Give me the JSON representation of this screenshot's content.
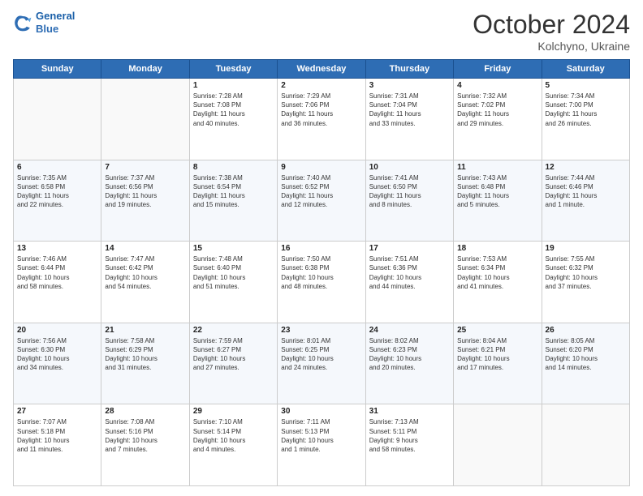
{
  "header": {
    "logo_line1": "General",
    "logo_line2": "Blue",
    "month_title": "October 2024",
    "location": "Kolchyno, Ukraine"
  },
  "weekdays": [
    "Sunday",
    "Monday",
    "Tuesday",
    "Wednesday",
    "Thursday",
    "Friday",
    "Saturday"
  ],
  "weeks": [
    [
      {
        "day": "",
        "info": ""
      },
      {
        "day": "",
        "info": ""
      },
      {
        "day": "1",
        "info": "Sunrise: 7:28 AM\nSunset: 7:08 PM\nDaylight: 11 hours\nand 40 minutes."
      },
      {
        "day": "2",
        "info": "Sunrise: 7:29 AM\nSunset: 7:06 PM\nDaylight: 11 hours\nand 36 minutes."
      },
      {
        "day": "3",
        "info": "Sunrise: 7:31 AM\nSunset: 7:04 PM\nDaylight: 11 hours\nand 33 minutes."
      },
      {
        "day": "4",
        "info": "Sunrise: 7:32 AM\nSunset: 7:02 PM\nDaylight: 11 hours\nand 29 minutes."
      },
      {
        "day": "5",
        "info": "Sunrise: 7:34 AM\nSunset: 7:00 PM\nDaylight: 11 hours\nand 26 minutes."
      }
    ],
    [
      {
        "day": "6",
        "info": "Sunrise: 7:35 AM\nSunset: 6:58 PM\nDaylight: 11 hours\nand 22 minutes."
      },
      {
        "day": "7",
        "info": "Sunrise: 7:37 AM\nSunset: 6:56 PM\nDaylight: 11 hours\nand 19 minutes."
      },
      {
        "day": "8",
        "info": "Sunrise: 7:38 AM\nSunset: 6:54 PM\nDaylight: 11 hours\nand 15 minutes."
      },
      {
        "day": "9",
        "info": "Sunrise: 7:40 AM\nSunset: 6:52 PM\nDaylight: 11 hours\nand 12 minutes."
      },
      {
        "day": "10",
        "info": "Sunrise: 7:41 AM\nSunset: 6:50 PM\nDaylight: 11 hours\nand 8 minutes."
      },
      {
        "day": "11",
        "info": "Sunrise: 7:43 AM\nSunset: 6:48 PM\nDaylight: 11 hours\nand 5 minutes."
      },
      {
        "day": "12",
        "info": "Sunrise: 7:44 AM\nSunset: 6:46 PM\nDaylight: 11 hours\nand 1 minute."
      }
    ],
    [
      {
        "day": "13",
        "info": "Sunrise: 7:46 AM\nSunset: 6:44 PM\nDaylight: 10 hours\nand 58 minutes."
      },
      {
        "day": "14",
        "info": "Sunrise: 7:47 AM\nSunset: 6:42 PM\nDaylight: 10 hours\nand 54 minutes."
      },
      {
        "day": "15",
        "info": "Sunrise: 7:48 AM\nSunset: 6:40 PM\nDaylight: 10 hours\nand 51 minutes."
      },
      {
        "day": "16",
        "info": "Sunrise: 7:50 AM\nSunset: 6:38 PM\nDaylight: 10 hours\nand 48 minutes."
      },
      {
        "day": "17",
        "info": "Sunrise: 7:51 AM\nSunset: 6:36 PM\nDaylight: 10 hours\nand 44 minutes."
      },
      {
        "day": "18",
        "info": "Sunrise: 7:53 AM\nSunset: 6:34 PM\nDaylight: 10 hours\nand 41 minutes."
      },
      {
        "day": "19",
        "info": "Sunrise: 7:55 AM\nSunset: 6:32 PM\nDaylight: 10 hours\nand 37 minutes."
      }
    ],
    [
      {
        "day": "20",
        "info": "Sunrise: 7:56 AM\nSunset: 6:30 PM\nDaylight: 10 hours\nand 34 minutes."
      },
      {
        "day": "21",
        "info": "Sunrise: 7:58 AM\nSunset: 6:29 PM\nDaylight: 10 hours\nand 31 minutes."
      },
      {
        "day": "22",
        "info": "Sunrise: 7:59 AM\nSunset: 6:27 PM\nDaylight: 10 hours\nand 27 minutes."
      },
      {
        "day": "23",
        "info": "Sunrise: 8:01 AM\nSunset: 6:25 PM\nDaylight: 10 hours\nand 24 minutes."
      },
      {
        "day": "24",
        "info": "Sunrise: 8:02 AM\nSunset: 6:23 PM\nDaylight: 10 hours\nand 20 minutes."
      },
      {
        "day": "25",
        "info": "Sunrise: 8:04 AM\nSunset: 6:21 PM\nDaylight: 10 hours\nand 17 minutes."
      },
      {
        "day": "26",
        "info": "Sunrise: 8:05 AM\nSunset: 6:20 PM\nDaylight: 10 hours\nand 14 minutes."
      }
    ],
    [
      {
        "day": "27",
        "info": "Sunrise: 7:07 AM\nSunset: 5:18 PM\nDaylight: 10 hours\nand 11 minutes."
      },
      {
        "day": "28",
        "info": "Sunrise: 7:08 AM\nSunset: 5:16 PM\nDaylight: 10 hours\nand 7 minutes."
      },
      {
        "day": "29",
        "info": "Sunrise: 7:10 AM\nSunset: 5:14 PM\nDaylight: 10 hours\nand 4 minutes."
      },
      {
        "day": "30",
        "info": "Sunrise: 7:11 AM\nSunset: 5:13 PM\nDaylight: 10 hours\nand 1 minute."
      },
      {
        "day": "31",
        "info": "Sunrise: 7:13 AM\nSunset: 5:11 PM\nDaylight: 9 hours\nand 58 minutes."
      },
      {
        "day": "",
        "info": ""
      },
      {
        "day": "",
        "info": ""
      }
    ]
  ]
}
